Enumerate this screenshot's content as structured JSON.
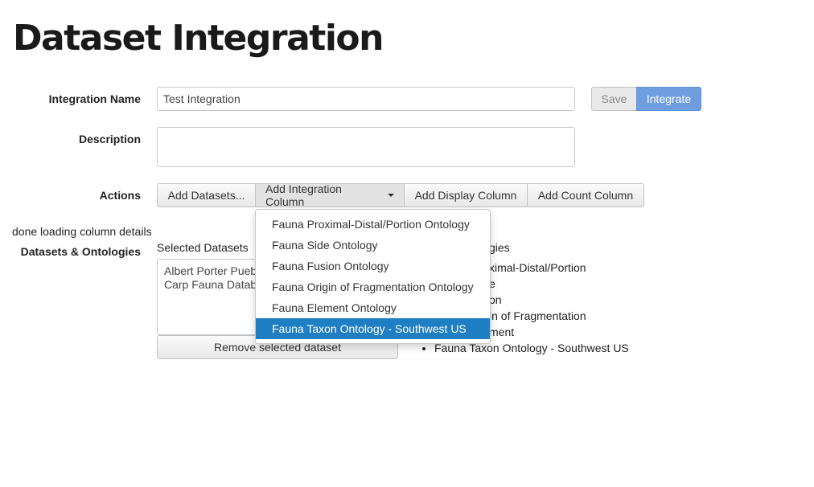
{
  "page": {
    "title": "Dataset Integration"
  },
  "form": {
    "name_label": "Integration Name",
    "name_value": "Test Integration",
    "description_label": "Description",
    "description_value": "",
    "save_label": "Save",
    "integrate_label": "Integrate",
    "actions_label": "Actions",
    "status_text": "done loading column details",
    "datasets_label": "Datasets & Ontologies"
  },
  "actions": {
    "add_datasets": "Add Datasets...",
    "add_integration_column": "Add Integration Column",
    "add_display_column": "Add Display Column",
    "add_count_column": "Add Count Column"
  },
  "selected_datasets": {
    "header": "Selected Datasets",
    "items": [
      "Albert Porter Pueb",
      "Carp Fauna Datab"
    ],
    "remove_label": "Remove selected dataset"
  },
  "ontologies": {
    "header_partial": "gies",
    "items": [
      "ximal-Distal/Portion",
      "e",
      "on",
      "in of Fragmentation",
      "ment",
      "Fauna Taxon Ontology - Southwest US"
    ]
  },
  "dropdown": {
    "items": [
      "Fauna Proximal-Distal/Portion Ontology",
      "Fauna Side Ontology",
      "Fauna Fusion Ontology",
      "Fauna Origin of Fragmentation Ontology",
      "Fauna Element Ontology",
      "Fauna Taxon Ontology - Southwest US"
    ],
    "active_index": 5
  },
  "colors": {
    "primary": "#6f9ee0",
    "highlight": "#1f7fc4"
  }
}
